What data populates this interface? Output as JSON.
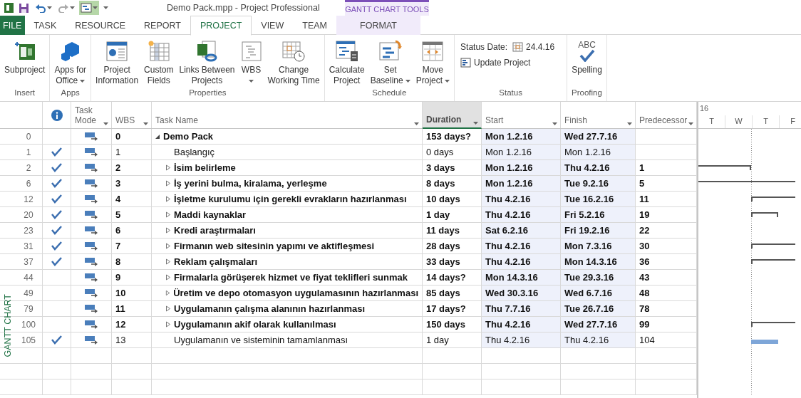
{
  "window": {
    "title": "Demo Pack.mpp - Project Professional",
    "context_tab_group": "GANTT CHART TOOLS"
  },
  "tabs": [
    {
      "label": "FILE",
      "kind": "file",
      "selected": false
    },
    {
      "label": "TASK",
      "kind": "normal",
      "selected": false
    },
    {
      "label": "RESOURCE",
      "kind": "normal",
      "selected": false
    },
    {
      "label": "REPORT",
      "kind": "normal",
      "selected": false
    },
    {
      "label": "PROJECT",
      "kind": "normal",
      "selected": true
    },
    {
      "label": "VIEW",
      "kind": "normal",
      "selected": false
    },
    {
      "label": "TEAM",
      "kind": "normal",
      "selected": false
    },
    {
      "label": "FORMAT",
      "kind": "context",
      "selected": false
    }
  ],
  "ribbon": {
    "groups": [
      {
        "label": "Insert",
        "items": [
          {
            "kind": "large",
            "lines": [
              "Subproject"
            ],
            "dropdown": false
          }
        ]
      },
      {
        "label": "Apps",
        "items": [
          {
            "kind": "large",
            "lines": [
              "Apps for",
              "Office"
            ],
            "dropdown": true
          }
        ]
      },
      {
        "label": "Properties",
        "items": [
          {
            "kind": "large",
            "lines": [
              "Project",
              "Information"
            ],
            "dropdown": false
          },
          {
            "kind": "large",
            "lines": [
              "Custom",
              "Fields"
            ],
            "dropdown": false
          },
          {
            "kind": "large",
            "lines": [
              "Links Between",
              "Projects"
            ],
            "dropdown": false
          },
          {
            "kind": "large",
            "lines": [
              "WBS"
            ],
            "dropdown": true
          },
          {
            "kind": "large",
            "lines": [
              "Change",
              "Working Time"
            ],
            "dropdown": false
          }
        ]
      },
      {
        "label": "Schedule",
        "items": [
          {
            "kind": "large",
            "lines": [
              "Calculate",
              "Project"
            ],
            "dropdown": false
          },
          {
            "kind": "large",
            "lines": [
              "Set",
              "Baseline"
            ],
            "dropdown": true
          },
          {
            "kind": "large",
            "lines": [
              "Move",
              "Project"
            ],
            "dropdown": true
          }
        ]
      },
      {
        "label": "Status",
        "items": [
          {
            "kind": "date",
            "label": "Status Date:",
            "value": "24.4.16"
          },
          {
            "kind": "small",
            "label": "Update Project"
          }
        ]
      },
      {
        "label": "Proofing",
        "items": [
          {
            "kind": "large",
            "icon_text": "ABC",
            "lines": [
              "Spelling"
            ],
            "dropdown": false
          }
        ]
      }
    ]
  },
  "view_label": "GANTT CHART",
  "sheet": {
    "columns": [
      {
        "kind": "icon",
        "selected": false
      },
      {
        "kind": "text",
        "label": "Task Mode",
        "selected": false
      },
      {
        "kind": "text",
        "label": "WBS",
        "selected": false
      },
      {
        "kind": "text",
        "label": "Task Name",
        "selected": false
      },
      {
        "kind": "text",
        "label": "Duration",
        "selected": true
      },
      {
        "kind": "text",
        "label": "Start",
        "selected": false
      },
      {
        "kind": "text",
        "label": "Finish",
        "selected": false
      },
      {
        "kind": "text",
        "label": "Predecessor",
        "selected": false
      }
    ],
    "tasks": [
      {
        "id": "0",
        "complete": false,
        "wbs": "0",
        "name": "Demo Pack",
        "kind": "summary",
        "expanded": true,
        "duration": "153 days?",
        "start": "Mon 1.2.16",
        "finish": "Wed 27.7.16",
        "children": [
          {
            "id": "1",
            "complete": true,
            "wbs": "1",
            "name": "Başlangıç",
            "kind": "task",
            "duration": "0 days",
            "start": "Mon 1.2.16",
            "finish": "Mon 1.2.16"
          },
          {
            "id": "2",
            "complete": true,
            "wbs": "2",
            "name": "İsim belirleme",
            "kind": "summary",
            "expanded": false,
            "duration": "3 days",
            "start": "Mon 1.2.16",
            "finish": "Thu 4.2.16",
            "predecessor": "1"
          },
          {
            "id": "6",
            "complete": true,
            "wbs": "3",
            "name": "İş yerini bulma, kiralama, yerleşme",
            "kind": "summary",
            "expanded": false,
            "duration": "8 days",
            "start": "Mon 1.2.16",
            "finish": "Tue 9.2.16",
            "predecessor": "5"
          },
          {
            "id": "12",
            "complete": true,
            "wbs": "4",
            "name": "İşletme kurulumu için gerekli evrakların hazırlanması",
            "kind": "summary",
            "expanded": false,
            "duration": "10 days",
            "start": "Thu 4.2.16",
            "finish": "Tue 16.2.16",
            "predecessor": "11"
          },
          {
            "id": "20",
            "complete": true,
            "wbs": "5",
            "name": "Maddi kaynaklar",
            "kind": "summary",
            "expanded": false,
            "duration": "1 day",
            "start": "Thu 4.2.16",
            "finish": "Fri 5.2.16",
            "predecessor": "19"
          },
          {
            "id": "23",
            "complete": true,
            "wbs": "6",
            "name": "Kredi araştırmaları",
            "kind": "summary",
            "expanded": false,
            "duration": "11 days",
            "start": "Sat 6.2.16",
            "finish": "Fri 19.2.16",
            "predecessor": "22"
          },
          {
            "id": "31",
            "complete": true,
            "wbs": "7",
            "name": "Firmanın web sitesinin yapımı ve aktifleşmesi",
            "kind": "summary",
            "expanded": false,
            "duration": "28 days",
            "start": "Thu 4.2.16",
            "finish": "Mon 7.3.16",
            "predecessor": "30"
          },
          {
            "id": "37",
            "complete": true,
            "wbs": "8",
            "name": "Reklam çalışmaları",
            "kind": "summary",
            "expanded": false,
            "duration": "33 days",
            "start": "Thu 4.2.16",
            "finish": "Mon 14.3.16",
            "predecessor": "36"
          },
          {
            "id": "44",
            "complete": false,
            "wbs": "9",
            "name": "Firmalarla görüşerek hizmet ve fiyat teklifleri sunmak",
            "kind": "summary",
            "expanded": false,
            "duration": "14 days?",
            "start": "Mon 14.3.16",
            "finish": "Tue 29.3.16",
            "predecessor": "43"
          },
          {
            "id": "49",
            "complete": false,
            "wbs": "10",
            "name": "Üretim ve depo otomasyon uygulamasının hazırlanması",
            "kind": "summary",
            "expanded": false,
            "duration": "85 days",
            "start": "Wed 30.3.16",
            "finish": "Wed 6.7.16",
            "predecessor": "48"
          },
          {
            "id": "79",
            "complete": false,
            "wbs": "11",
            "name": "Uygulamanın çalışma alanının hazırlanması",
            "kind": "summary",
            "expanded": false,
            "duration": "17 days?",
            "start": "Thu 7.7.16",
            "finish": "Tue 26.7.16",
            "predecessor": "78"
          },
          {
            "id": "100",
            "complete": false,
            "wbs": "12",
            "name": "Uygulamanın akif olarak kullanılması",
            "kind": "summary",
            "expanded": false,
            "duration": "150 days",
            "start": "Thu 4.2.16",
            "finish": "Wed 27.7.16",
            "predecessor": "99"
          },
          {
            "id": "105",
            "complete": true,
            "wbs": "13",
            "name": "Uygulamanın ve sisteminin tamamlanması",
            "kind": "task",
            "duration": "1 day",
            "start": "Thu 4.2.16",
            "finish": "Thu 4.2.16",
            "predecessor": "104"
          }
        ]
      }
    ]
  },
  "gantt": {
    "period": "16",
    "days": [
      "T",
      "W",
      "T",
      "F"
    ]
  }
}
